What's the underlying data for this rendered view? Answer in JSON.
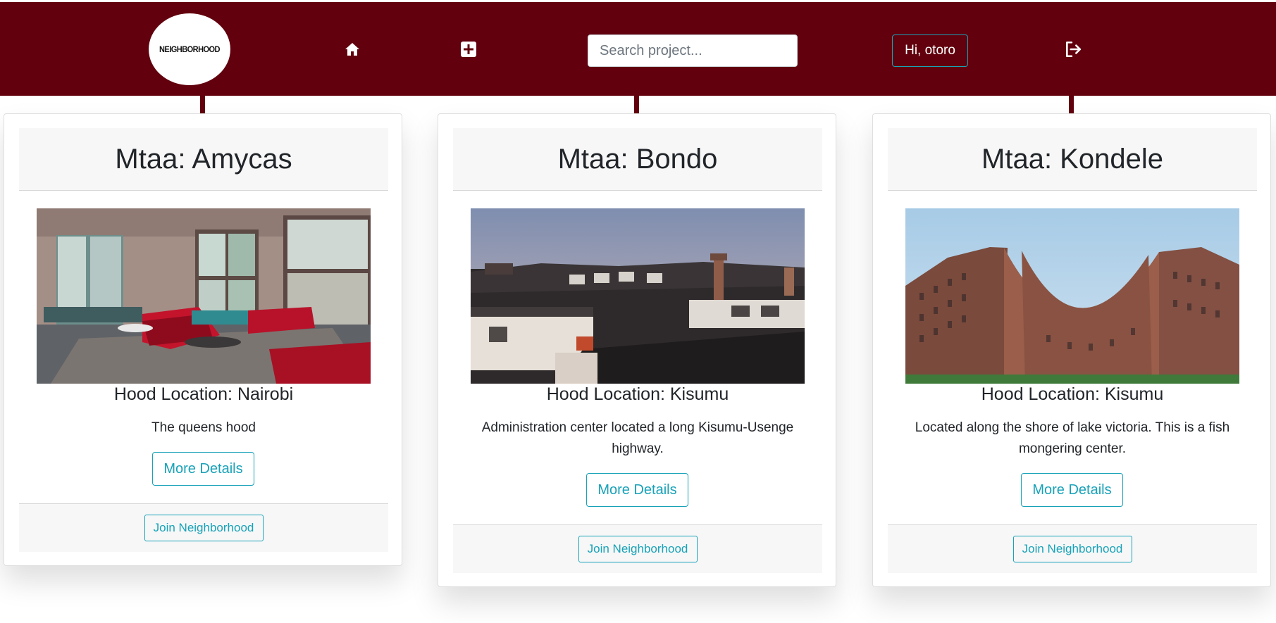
{
  "navbar": {
    "logo_text": "NEIGHBORHOOD",
    "home_icon": "home-icon",
    "add_icon": "plus-square-icon",
    "search_placeholder": "Search project...",
    "greeting": "Hi, otoro",
    "logout_icon": "sign-out-icon",
    "background_color": "#62000d"
  },
  "accent_color": "#17a2b8",
  "cards": [
    {
      "title": "Mtaa: Amycas",
      "image": "living-room-photo",
      "location": "Hood Location: Nairobi",
      "description": "The queens hood",
      "details_label": "More Details",
      "join_label": "Join Neighborhood"
    },
    {
      "title": "Mtaa: Bondo",
      "image": "rooftops-photo",
      "location": "Hood Location: Kisumu",
      "description": "Administration center located a long Kisumu-Usenge highway.",
      "details_label": "More Details",
      "join_label": "Join Neighborhood"
    },
    {
      "title": "Mtaa: Kondele",
      "image": "curved-building-photo",
      "location": "Hood Location: Kisumu",
      "description": "Located along the shore of lake victoria. This is a fish mongering center.",
      "details_label": "More Details",
      "join_label": "Join Neighborhood"
    }
  ]
}
